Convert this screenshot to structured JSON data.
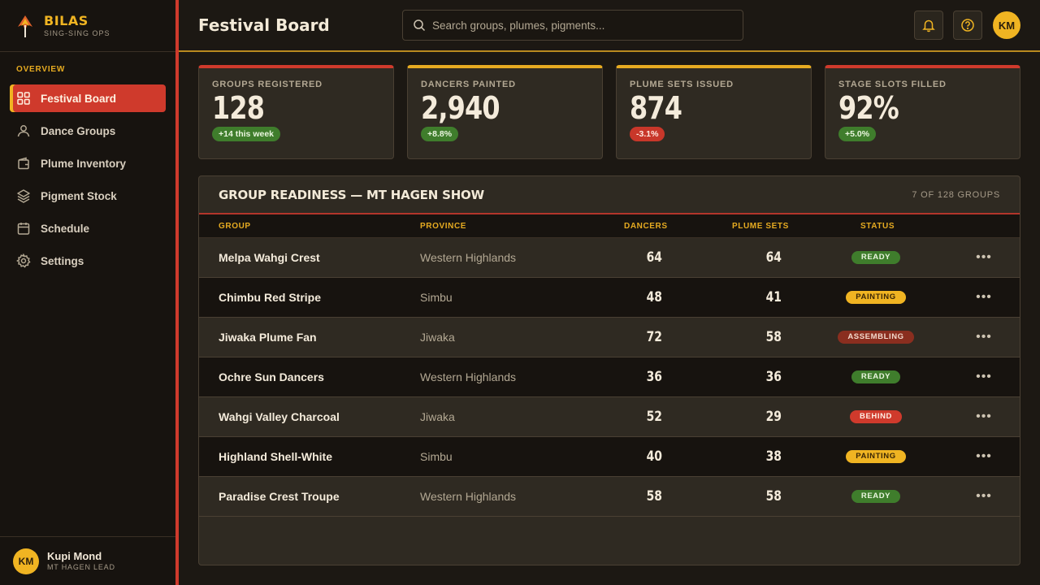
{
  "brand": {
    "name": "BILAS",
    "tagline": "SING-SING OPS"
  },
  "nav": {
    "section": "OVERVIEW",
    "items": [
      {
        "label": "Festival Board",
        "icon": "grid-icon",
        "active": true
      },
      {
        "label": "Dance Groups",
        "icon": "user-icon",
        "active": false
      },
      {
        "label": "Plume Inventory",
        "icon": "wallet-icon",
        "active": false
      },
      {
        "label": "Pigment Stock",
        "icon": "layers-icon",
        "active": false
      },
      {
        "label": "Schedule",
        "icon": "calendar-icon",
        "active": false
      },
      {
        "label": "Settings",
        "icon": "gear-icon",
        "active": false
      }
    ]
  },
  "user": {
    "initials": "KM",
    "name": "Kupi Mond",
    "role": "MT HAGEN LEAD"
  },
  "header": {
    "title": "Festival Board",
    "search_placeholder": "Search groups, plumes, pigments...",
    "avatar_initials": "KM"
  },
  "kpis": [
    {
      "label": "GROUPS REGISTERED",
      "value": "128",
      "delta": "+14 this week",
      "trend": "up",
      "accent": "#cf3a2c"
    },
    {
      "label": "DANCERS PAINTED",
      "value": "2,940",
      "delta": "+8.8%",
      "trend": "up",
      "accent": "#e6ab21"
    },
    {
      "label": "PLUME SETS ISSUED",
      "value": "874",
      "delta": "-3.1%",
      "trend": "down",
      "accent": "#e6ab21"
    },
    {
      "label": "STAGE SLOTS FILLED",
      "value": "92%",
      "delta": "+5.0%",
      "trend": "up",
      "accent": "#cf3a2c"
    }
  ],
  "table": {
    "title": "GROUP READINESS — MT HAGEN SHOW",
    "count": "7 OF 128 GROUPS",
    "columns": {
      "group": "GROUP",
      "province": "PROVINCE",
      "dancers": "DANCERS",
      "plumes": "PLUME SETS",
      "status": "STATUS"
    },
    "rows": [
      {
        "group": "Melpa Wahgi Crest",
        "province": "Western Highlands",
        "dancers": "64",
        "plumes": "64",
        "status": "READY"
      },
      {
        "group": "Chimbu Red Stripe",
        "province": "Simbu",
        "dancers": "48",
        "plumes": "41",
        "status": "PAINTING"
      },
      {
        "group": "Jiwaka Plume Fan",
        "province": "Jiwaka",
        "dancers": "72",
        "plumes": "58",
        "status": "ASSEMBLING"
      },
      {
        "group": "Ochre Sun Dancers",
        "province": "Western Highlands",
        "dancers": "36",
        "plumes": "36",
        "status": "READY"
      },
      {
        "group": "Wahgi Valley Charcoal",
        "province": "Jiwaka",
        "dancers": "52",
        "plumes": "29",
        "status": "BEHIND"
      },
      {
        "group": "Highland Shell-White",
        "province": "Simbu",
        "dancers": "40",
        "plumes": "38",
        "status": "PAINTING"
      },
      {
        "group": "Paradise Crest Troupe",
        "province": "Western Highlands",
        "dancers": "58",
        "plumes": "58",
        "status": "READY"
      }
    ]
  },
  "colors": {
    "accent_red": "#cf3a2c",
    "accent_gold": "#f0b422",
    "ready": "#3f7d2c",
    "behind": "#cf3a2c"
  }
}
